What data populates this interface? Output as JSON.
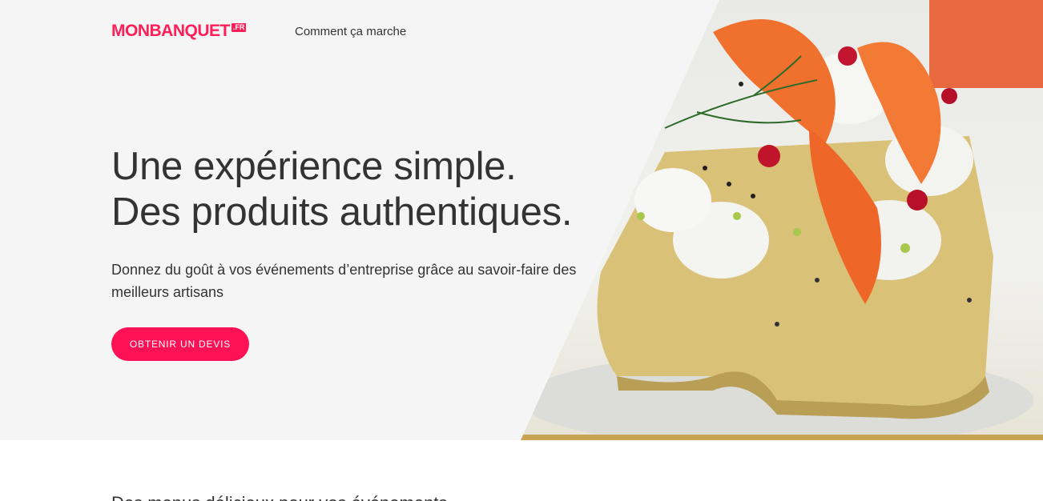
{
  "header": {
    "logo_text": "MONBANQUET",
    "logo_suffix": ".FR",
    "nav_link": "Comment ça marche"
  },
  "hero": {
    "headline_line1": "Une expérience simple.",
    "headline_line2": "Des produits authentiques.",
    "subtext": "Donnez du goût à vos événements d’entreprise grâce au savoir-faire des meilleurs artisans",
    "cta_label": "OBTENIR UN DEVIS",
    "image_alt": "canapé-salmon-cream-dill-icon"
  },
  "section": {
    "heading_partial": "Des menus délicieux pour vos événements"
  },
  "colors": {
    "brand": "#ff1e57",
    "hero_bg": "#f5f5f5",
    "text": "#333333"
  }
}
